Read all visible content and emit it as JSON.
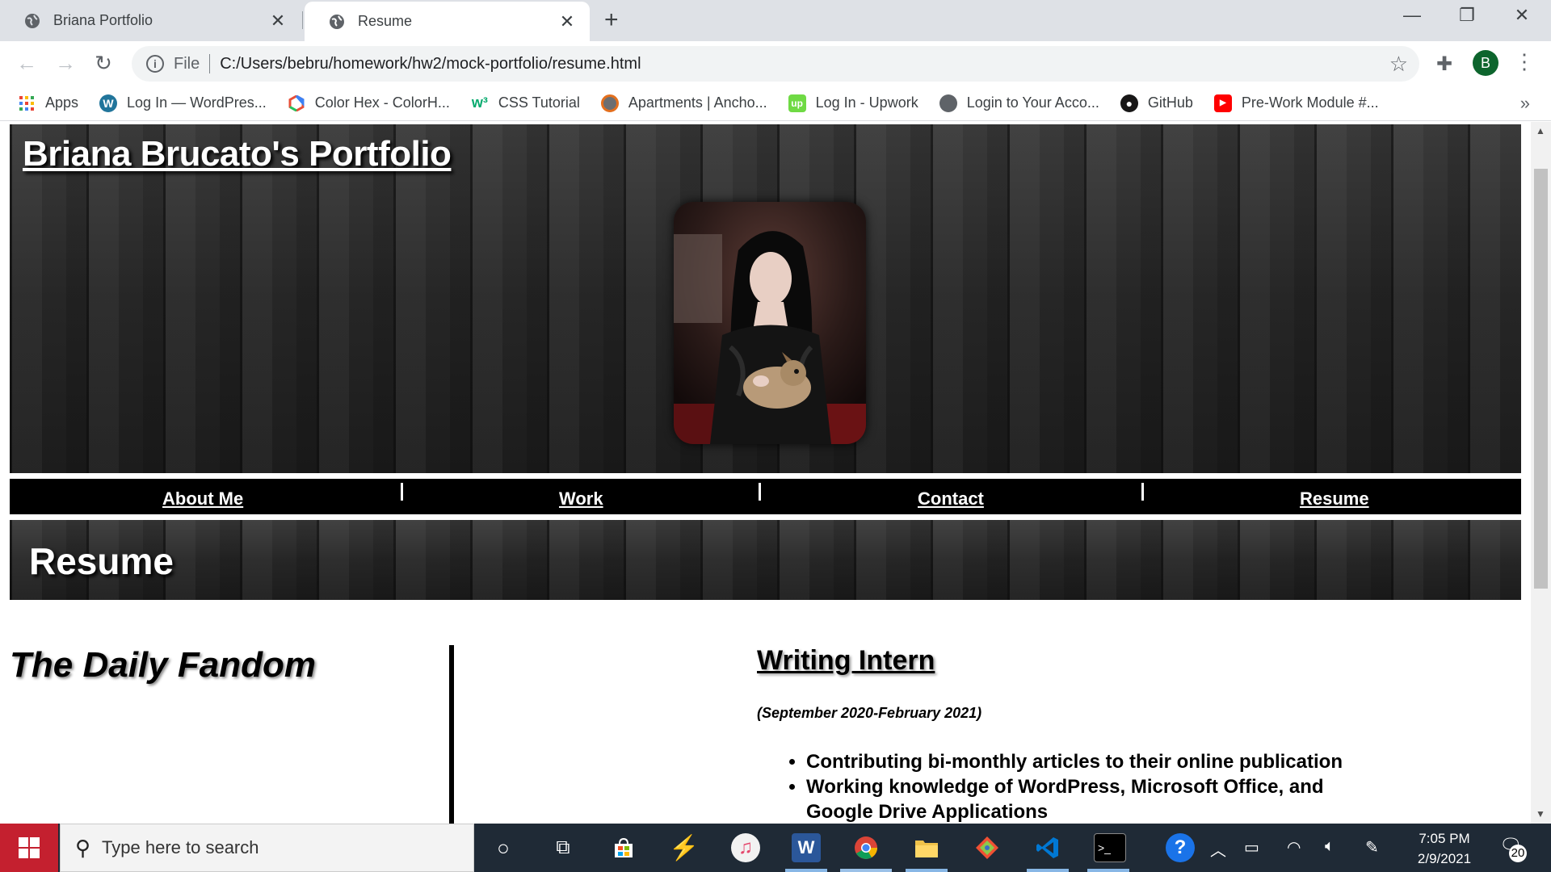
{
  "browser": {
    "tabs": [
      {
        "title": "Briana Portfolio",
        "active": false
      },
      {
        "title": "Resume",
        "active": true
      }
    ],
    "new_tab": "+",
    "window_controls": {
      "minimize": "—",
      "restore": "❐",
      "close": "✕"
    },
    "address": {
      "scheme": "File",
      "url": "C:/Users/bebru/homework/hw2/mock-portfolio/resume.html"
    },
    "profile_initial": "B",
    "bookmarks": [
      {
        "label": "Apps",
        "icon": "apps-grid-icon"
      },
      {
        "label": "Log In — WordPres...",
        "icon": "wordpress-icon"
      },
      {
        "label": "Color Hex - ColorH...",
        "icon": "colorhex-icon"
      },
      {
        "label": "CSS Tutorial",
        "icon": "w3schools-icon"
      },
      {
        "label": "Apartments | Ancho...",
        "icon": "apartments-icon"
      },
      {
        "label": "Log In - Upwork",
        "icon": "upwork-icon"
      },
      {
        "label": "Login to Your Acco...",
        "icon": "globe-icon"
      },
      {
        "label": "GitHub",
        "icon": "github-icon"
      },
      {
        "label": "Pre-Work Module #...",
        "icon": "youtube-icon"
      }
    ],
    "bookmarks_more": "»"
  },
  "page": {
    "site_title": "Briana Brucato's Portfolio",
    "nav": [
      "About Me",
      "Work",
      "Contact",
      "Resume"
    ],
    "section_title": "Resume",
    "company": "The Daily Fandom",
    "job": {
      "title": "Writing Intern",
      "dates": "(September 2020-February 2021)",
      "duties": [
        "Contributing bi-monthly articles to their online publication",
        "Working knowledge of WordPress, Microsoft Office, and Google Drive Applications"
      ]
    }
  },
  "taskbar": {
    "search_placeholder": "Type here to search",
    "time": "7:05 PM",
    "date": "2/9/2021",
    "notification_count": "20"
  },
  "colors": {
    "accent_red": "#c4202f",
    "taskbar": "#1f2a36",
    "tab_strip": "#dee1e6"
  }
}
